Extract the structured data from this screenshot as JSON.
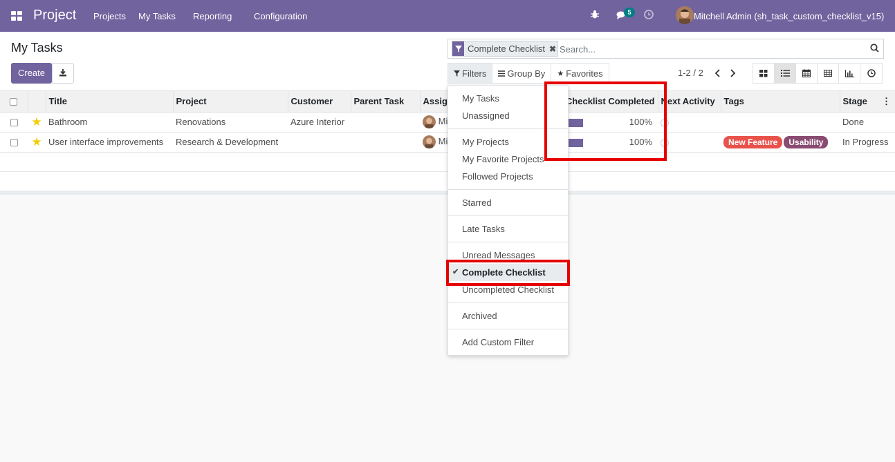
{
  "navbar": {
    "app_name": "Project",
    "menu": [
      "Projects",
      "My Tasks",
      "Reporting",
      "Configuration"
    ],
    "message_count": "5",
    "user_name": "Mitchell Admin (sh_task_custom_checklist_v15)"
  },
  "control_panel": {
    "title": "My Tasks",
    "create_label": "Create",
    "search": {
      "facet_label": "Complete Checklist",
      "placeholder": "Search..."
    },
    "filters_label": "Filters",
    "groupby_label": "Group By",
    "favorites_label": "Favorites",
    "pager": "1-2 / 2"
  },
  "table": {
    "columns": [
      "Title",
      "Project",
      "Customer",
      "Parent Task",
      "Assig",
      "Checklist Completed",
      "Next Activity",
      "Tags",
      "Stage"
    ],
    "rows": [
      {
        "title": "Bathroom",
        "project": "Renovations",
        "customer": "Azure Interior",
        "parent": "",
        "assignee": "Mi",
        "checklist": "100%",
        "tags": [],
        "stage": "Done"
      },
      {
        "title": "User interface improvements",
        "project": "Research & Development",
        "customer": "",
        "parent": "",
        "assignee": "Mi",
        "checklist": "100%",
        "tags": [
          "New Feature",
          "Usability"
        ],
        "stage": "In Progress"
      }
    ]
  },
  "filters_menu": {
    "items": [
      "My Tasks",
      "Unassigned",
      "My Projects",
      "My Favorite Projects",
      "Followed Projects",
      "Starred",
      "Late Tasks",
      "Unread Messages",
      "Complete Checklist",
      "Uncompleted Checklist",
      "Archived",
      "Add Custom Filter"
    ],
    "selected": "Complete Checklist"
  },
  "colors": {
    "brand": "#71639e",
    "tag_new_feature": "#e8524a",
    "tag_usability": "#8a4b72",
    "annotation": "#e60000"
  }
}
